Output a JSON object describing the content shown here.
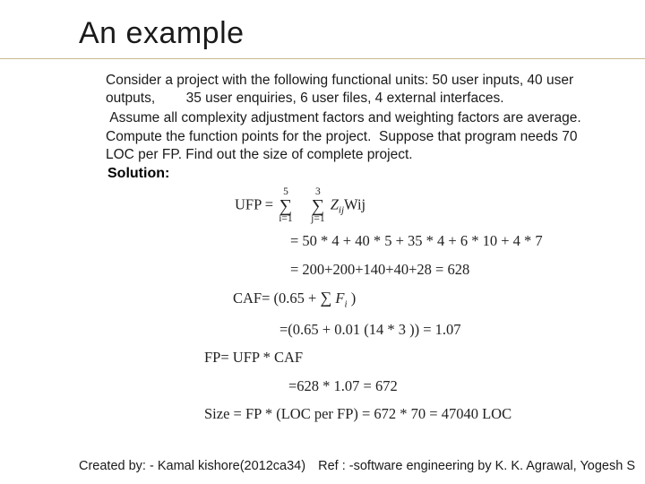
{
  "title": "An example",
  "problem": {
    "line1": "Consider a project with the following functional units: 50 user inputs, 40 user outputs,        35 user enquiries, 6 user files, 4 external interfaces.",
    "line2": " Assume all complexity adjustment factors and weighting factors are average.",
    "line3": "Compute the function points for the project.  Suppose that program needs 70 LOC per FP. Find out the size of complete project."
  },
  "solution_label": "Solution:",
  "math": {
    "ufp_prefix": "UFP = ",
    "sum1_top": "5",
    "sum1_bot": "i=1",
    "sum2_top": "3",
    "sum2_bot": "j=1",
    "ufp_suffix_a": "Z",
    "ufp_suffix_sub": "ij",
    "ufp_suffix_b": "Wij",
    "ufp_expand": "= 50 * 4 + 40 * 5 + 35 * 4 + 6 * 10 + 4 * 7",
    "ufp_result": "= 200+200+140+40+28 = 628",
    "caf_prefix": "CAF= (0.65 + ",
    "caf_sub": "i",
    "caf_suffix": " )",
    "caf_sym": "F",
    "caf_result": "=(0.65 + 0.01 (14 * 3 )) = 1.07",
    "fp_line1": "FP= UFP * CAF",
    "fp_line2": "=628 * 1.07 = 672",
    "size_line": "Size = FP * (LOC per FP) = 672 * 70 = 47040 LOC"
  },
  "footer": {
    "created": "Created by: - Kamal kishore(2012ca34)",
    "ref": "Ref : -software engineering by K. K. Agrawal, Yogesh S"
  }
}
